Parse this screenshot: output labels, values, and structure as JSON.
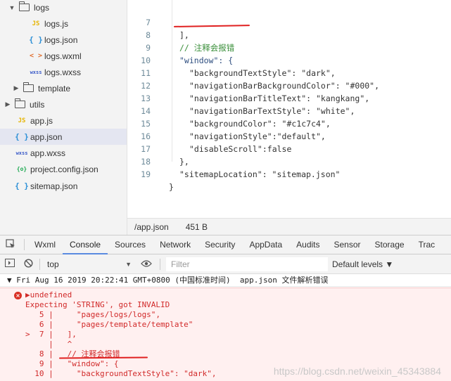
{
  "file_tree": {
    "items": [
      {
        "label": "logs",
        "type": "folder",
        "arrow": "▼"
      },
      {
        "label": "logs.js",
        "type": "js",
        "icon": "JS"
      },
      {
        "label": "logs.json",
        "type": "json",
        "icon": "{ }"
      },
      {
        "label": "logs.wxml",
        "type": "wxml",
        "icon": "< >"
      },
      {
        "label": "logs.wxss",
        "type": "wxss",
        "icon": "wxss"
      },
      {
        "label": "template",
        "type": "folder",
        "arrow": "▶"
      },
      {
        "label": "utils",
        "type": "folder",
        "arrow": "▶"
      },
      {
        "label": "app.js",
        "type": "js",
        "icon": "JS"
      },
      {
        "label": "app.json",
        "type": "json",
        "icon": "{ }"
      },
      {
        "label": "app.wxss",
        "type": "wxss",
        "icon": "wxss"
      },
      {
        "label": "project.config.json",
        "type": "proj",
        "icon": "{o}"
      },
      {
        "label": "sitemap.json",
        "type": "json",
        "icon": "{ }"
      }
    ]
  },
  "editor": {
    "lines": [
      {
        "n": "7",
        "text": "],"
      },
      {
        "n": "8",
        "text": "// 注释会报错"
      },
      {
        "n": "9",
        "text": "\"window\": {"
      },
      {
        "n": "10",
        "text": "\"backgroundTextStyle\": \"dark\","
      },
      {
        "n": "11",
        "text": "\"navigationBarBackgroundColor\": \"#000\","
      },
      {
        "n": "12",
        "text": "\"navigationBarTitleText\": \"kangkang\","
      },
      {
        "n": "13",
        "text": "\"navigationBarTextStyle\": \"white\","
      },
      {
        "n": "14",
        "text": "\"backgroundColor\": \"#c1c7c4\","
      },
      {
        "n": "15",
        "text": "\"navigationStyle\":\"default\","
      },
      {
        "n": "16",
        "text": "\"disableScroll\":false"
      },
      {
        "n": "17",
        "text": "},"
      },
      {
        "n": "18",
        "text": "\"sitemapLocation\": \"sitemap.json\""
      },
      {
        "n": "19",
        "text": "}"
      }
    ]
  },
  "status_bar": {
    "path": "/app.json",
    "size": "451 B"
  },
  "devtools": {
    "tabs": [
      "Wxml",
      "Console",
      "Sources",
      "Network",
      "Security",
      "AppData",
      "Audits",
      "Sensor",
      "Storage",
      "Trac"
    ],
    "active_tab": "Console",
    "context": "top",
    "filter_placeholder": "Filter",
    "levels": "Default levels ▼"
  },
  "console": {
    "group_header": "▼ Fri Aug 16 2019 20:22:41 GMT+0800 (中国标准时间)  app.json 文件解析错误",
    "error_lines": [
      "▶undefined",
      "Expecting 'STRING', got INVALID",
      "   5 |     \"pages/logs/logs\",",
      "   6 |     \"pages/template/template\"",
      ">  7 |   ],",
      "     |   ^",
      "   8 |   // 注释会报错",
      "   9 |   \"window\": {",
      "  10 |     \"backgroundTextStyle\": \"dark\","
    ],
    "watermark": "https://blog.csdn.net/weixin_45343884"
  },
  "colors": {
    "accent_tab": "#5a8be0",
    "error_text": "#d12a2a",
    "error_bg": "#fff0f0",
    "annotation_red": "#e02020"
  }
}
